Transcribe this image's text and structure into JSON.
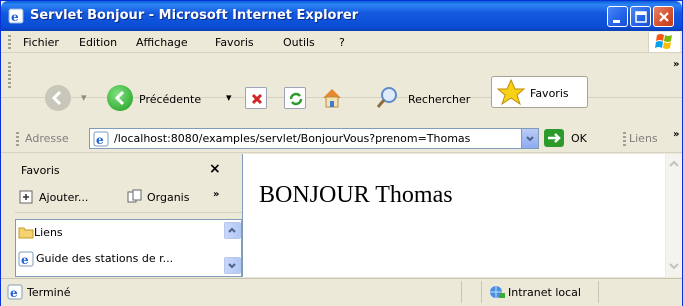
{
  "window": {
    "title": "Servlet Bonjour - Microsoft Internet Explorer"
  },
  "menu": {
    "items": [
      {
        "label": "Fichier"
      },
      {
        "label": "Edition"
      },
      {
        "label": "Affichage"
      },
      {
        "label": "Favoris"
      },
      {
        "label": "Outils"
      },
      {
        "label": "?"
      }
    ]
  },
  "toolbar": {
    "back_label": "Précédente",
    "search_label": "Rechercher",
    "favorites_label": "Favoris"
  },
  "address": {
    "label": "Adresse",
    "url": "/localhost:8080/examples/servlet/BonjourVous?prenom=Thomas",
    "go_label": "OK",
    "links_label": "Liens"
  },
  "favorites_pane": {
    "title": "Favoris",
    "add_label": "Ajouter...",
    "organize_label": "Organis",
    "items": [
      {
        "label": "Liens"
      },
      {
        "label": "Guide des stations de r..."
      }
    ]
  },
  "content": {
    "text": "BONJOUR Thomas"
  },
  "status": {
    "text": "Terminé",
    "zone": "Intranet local"
  },
  "colors": {
    "title_bar": "#0B4ED6",
    "chrome": "#ECE9D8",
    "close_button": "#D5532F",
    "go_button": "#2B9A2B"
  },
  "icons": [
    "ie-icon",
    "minimize-icon",
    "maximize-icon",
    "close-icon",
    "windows-logo-icon",
    "back-icon",
    "forward-icon",
    "stop-icon",
    "refresh-icon",
    "home-icon",
    "search-icon",
    "favorites-star-icon",
    "page-icon",
    "go-arrow-icon",
    "add-favorite-icon",
    "organize-icon",
    "folder-icon",
    "intranet-icon"
  ]
}
